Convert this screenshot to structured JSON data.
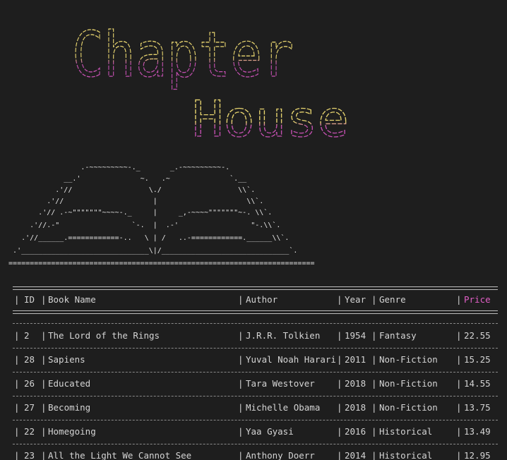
{
  "banner": {
    "line1": "Chapter",
    "line2": "House",
    "ascii_colors": [
      "#e6d36e",
      "#e6d36e",
      "#e6d36e",
      "#e6d36e",
      "#c34fb0",
      "#c34fb0"
    ]
  },
  "book_art": {
    "lines": [
      "                   .-~~~~~~~~~-._       _.-~~~~~~~~~-.",
      "               __.'              ~.   .~              `.__",
      "             .'//                  \\./                  \\\\`.",
      "           .'//                     |                     \\\\`.",
      "         .'// .-~\"\"\"\"\"\"\"~~~~-._     |     _,-~~~~\"\"\"\"\"\"\"~-. \\\\`.",
      "       .'//.-\"                 `-.  |  .-'                 \"-.\\\\`.",
      "     .'//______.============-..   \\ | /   ..-============.______\\\\`.",
      "   .'______________________________\\|/______________________________`.",
      "  ========================================================================"
    ]
  },
  "table": {
    "headers": [
      "ID",
      "Book Name",
      "Author",
      "Year",
      "Genre",
      "Price"
    ],
    "rows": [
      [
        "2",
        "The Lord of the Rings",
        "J.R.R. Tolkien",
        "1954",
        "Fantasy",
        "22.55"
      ],
      [
        "28",
        "Sapiens",
        "Yuval Noah Harari",
        "2011",
        "Non-Fiction",
        "15.25"
      ],
      [
        "26",
        "Educated",
        "Tara Westover",
        "2018",
        "Non-Fiction",
        "14.55"
      ],
      [
        "27",
        "Becoming",
        "Michelle Obama",
        "2018",
        "Non-Fiction",
        "13.75"
      ],
      [
        "22",
        "Homegoing",
        "Yaa Gyasi",
        "2016",
        "Historical",
        "13.49"
      ],
      [
        "23",
        "All the Light We Cannot See",
        "Anthony Doerr",
        "2014",
        "Historical",
        "12.95"
      ]
    ]
  },
  "colors": {
    "background": "#1e1e1e",
    "yellow": "#e6d36e",
    "magenta": "#c34fb0",
    "price_header": "#e15fc6"
  }
}
